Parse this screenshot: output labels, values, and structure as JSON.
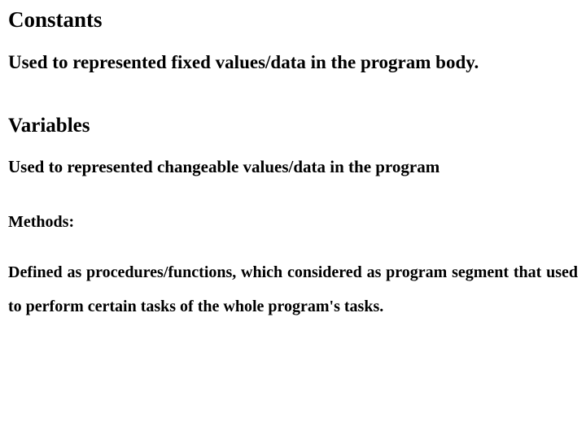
{
  "sections": {
    "constants": {
      "heading": "Constants",
      "body": "Used to represented fixed values/data in the program body."
    },
    "variables": {
      "heading": "Variables",
      "body": "Used to represented changeable values/data in the program"
    },
    "methods": {
      "heading": "Methods:",
      "body": "Defined as procedures/functions, which considered as program segment that used to perform certain tasks of the whole program's tasks."
    }
  }
}
